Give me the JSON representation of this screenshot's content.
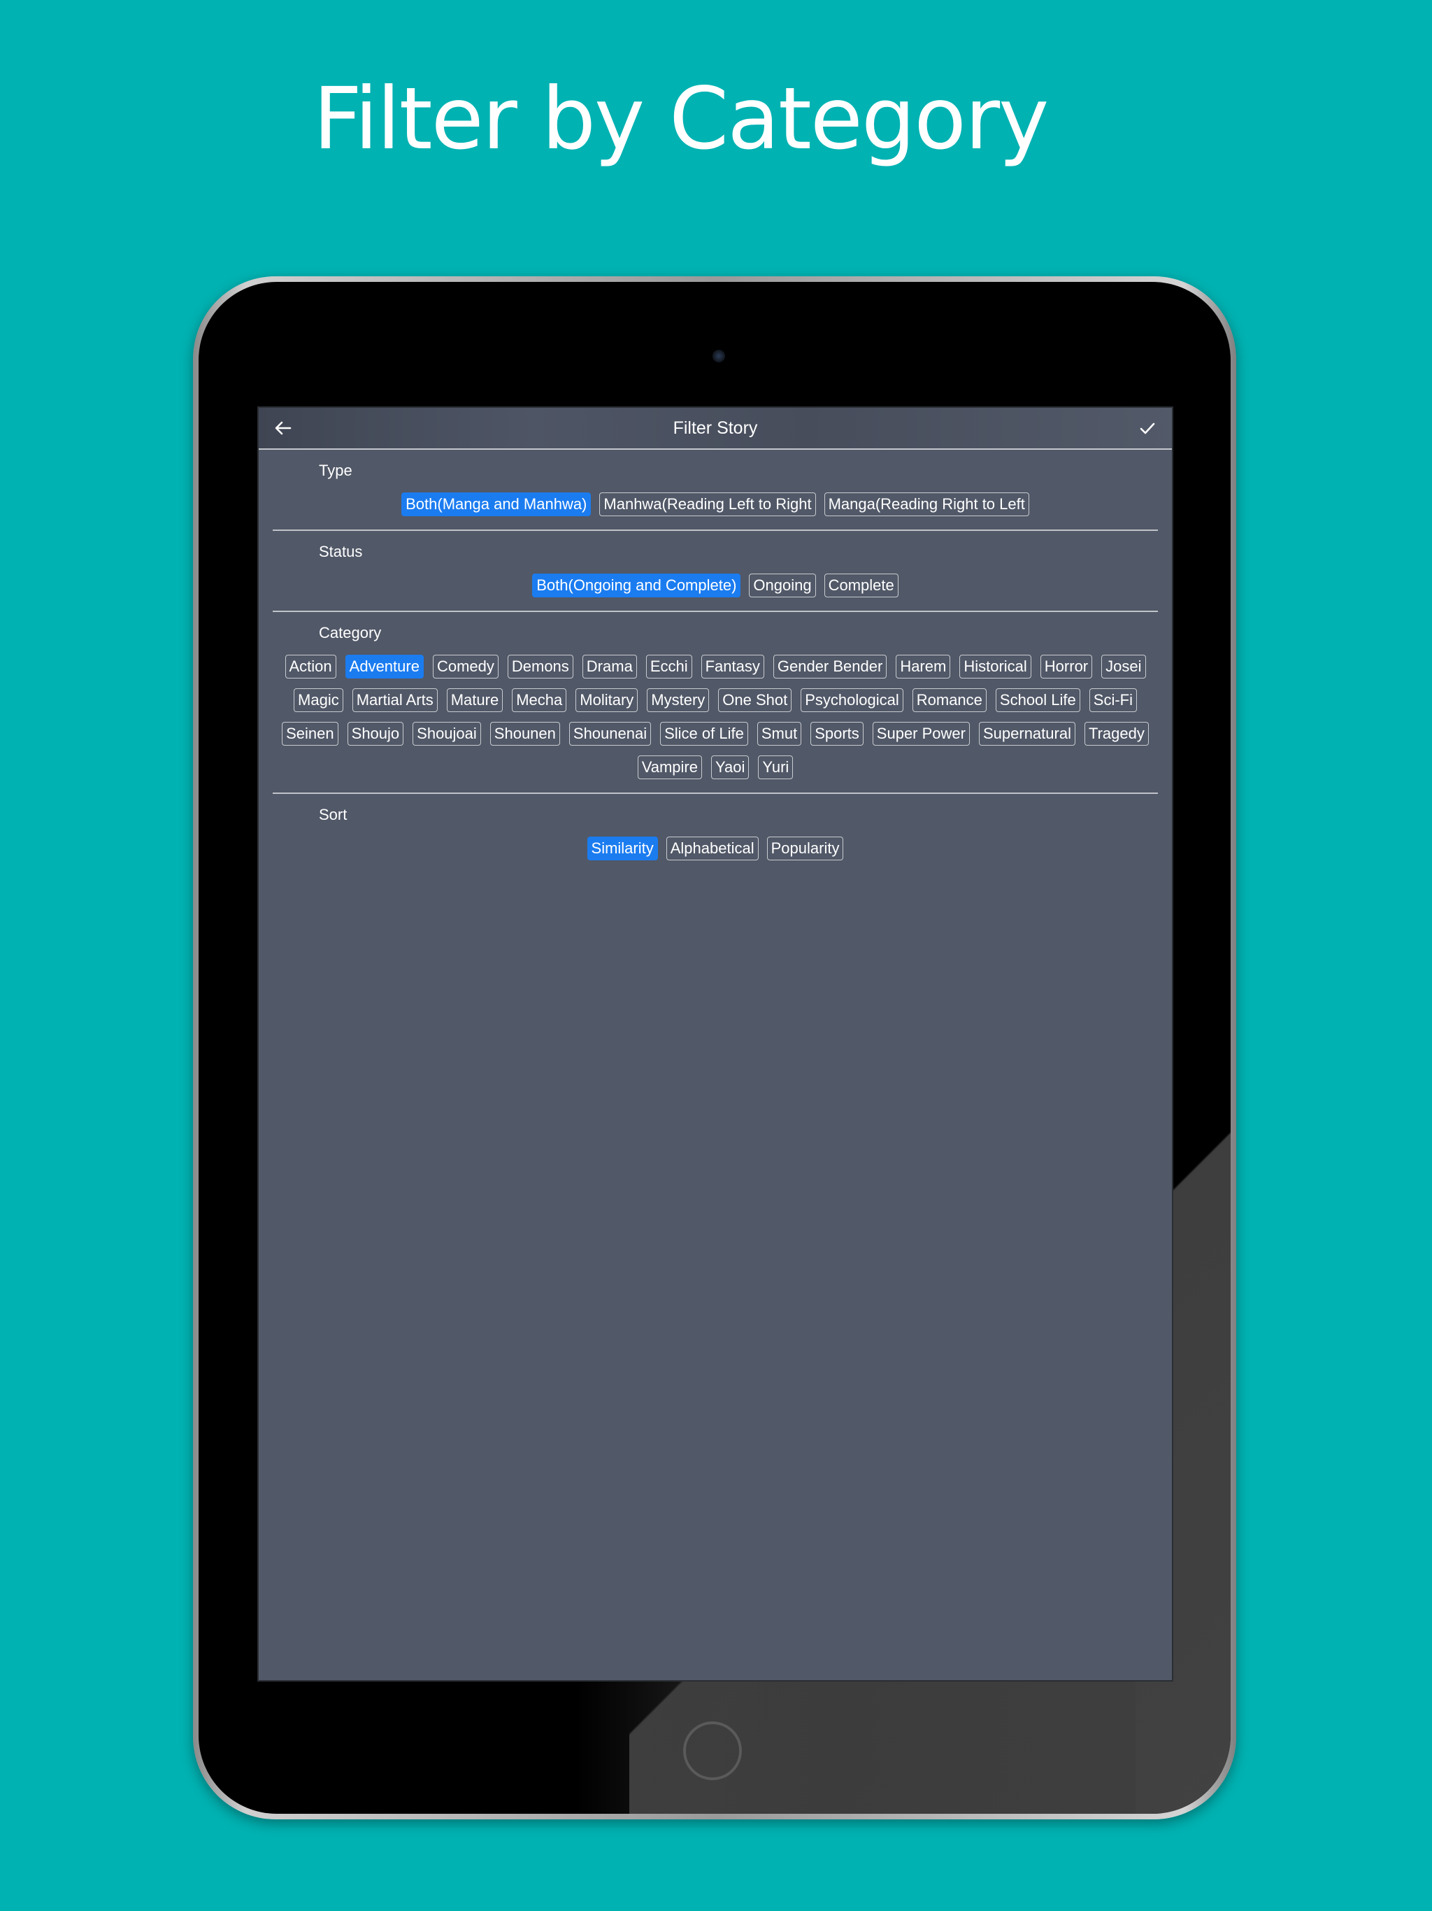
{
  "headline": "Filter by Category",
  "nav": {
    "title": "Filter Story",
    "back_icon": "arrow-left-icon",
    "done_icon": "checkmark-icon"
  },
  "sections": {
    "type": {
      "label": "Type",
      "options": [
        "Both(Manga and Manhwa)",
        "Manhwa(Reading Left to Right",
        "Manga(Reading Right to Left"
      ],
      "selected": "Both(Manga and Manhwa)"
    },
    "status": {
      "label": "Status",
      "options": [
        "Both(Ongoing and Complete)",
        "Ongoing",
        "Complete"
      ],
      "selected": "Both(Ongoing and Complete)"
    },
    "category": {
      "label": "Category",
      "options": [
        "Action",
        "Adventure",
        "Comedy",
        "Demons",
        "Drama",
        "Ecchi",
        "Fantasy",
        "Gender Bender",
        "Harem",
        "Historical",
        "Horror",
        "Josei",
        "Magic",
        "Martial Arts",
        "Mature",
        "Mecha",
        "Molitary",
        "Mystery",
        "One Shot",
        "Psychological",
        "Romance",
        "School Life",
        "Sci-Fi",
        "Seinen",
        "Shoujo",
        "Shoujoai",
        "Shounen",
        "Shounenai",
        "Slice of Life",
        "Smut",
        "Sports",
        "Super Power",
        "Supernatural",
        "Tragedy",
        "Vampire",
        "Yaoi",
        "Yuri"
      ],
      "selected": "Adventure"
    },
    "sort": {
      "label": "Sort",
      "options": [
        "Similarity",
        "Alphabetical",
        "Popularity"
      ],
      "selected": "Similarity"
    }
  },
  "colors": {
    "background": "#00b2b2",
    "screen": "#515867",
    "selected_chip": "#1b7cf0",
    "chip_border": "#c8cbd0",
    "text": "#ffffff"
  }
}
